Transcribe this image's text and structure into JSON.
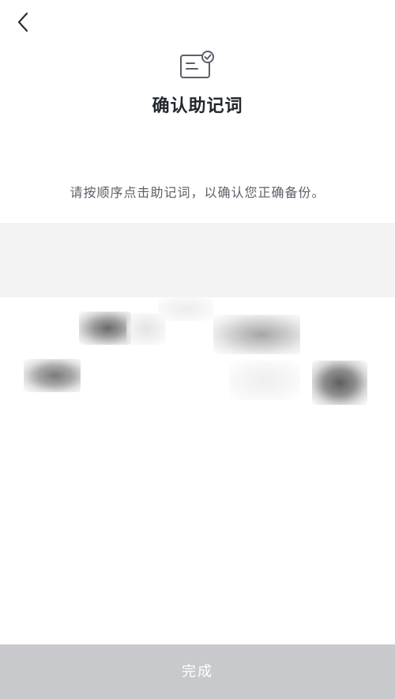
{
  "header": {
    "title": "确认助记词",
    "back_icon": "chevron-left-icon",
    "title_icon": "document-check-icon"
  },
  "instruction": "请按顺序点击助记词，以确认您正确备份。",
  "words": [
    {
      "id": 1,
      "label": ""
    },
    {
      "id": 2,
      "label": ""
    },
    {
      "id": 3,
      "label": ""
    },
    {
      "id": 4,
      "label": ""
    },
    {
      "id": 5,
      "label": ""
    },
    {
      "id": 6,
      "label": ""
    },
    {
      "id": 7,
      "label": ""
    }
  ],
  "footer": {
    "done_label": "完成"
  },
  "colors": {
    "button_disabled": "#c8c9cc",
    "selected_area_bg": "#f3f3f3",
    "text_primary": "#23272e",
    "text_secondary": "#5b6068"
  }
}
